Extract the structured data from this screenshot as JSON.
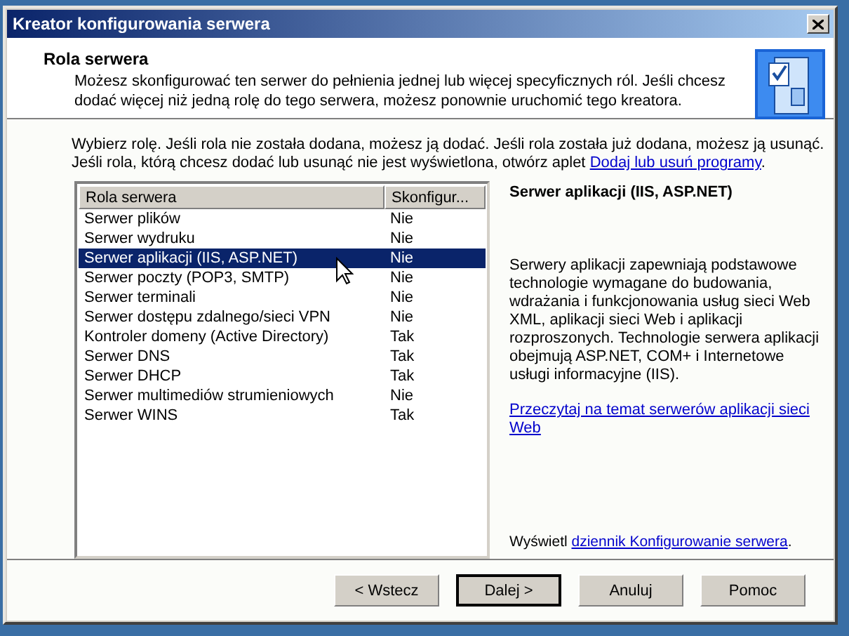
{
  "window": {
    "title": "Kreator konfigurowania serwera"
  },
  "header": {
    "title": "Rola serwera",
    "description": "Możesz skonfigurować ten serwer do pełnienia jednej lub więcej specyficznych ról. Jeśli chcesz dodać więcej niż jedną rolę do tego serwera, możesz ponownie uruchomić tego kreatora."
  },
  "instructions": {
    "text": "Wybierz rolę. Jeśli rola nie została dodana, możesz ją dodać. Jeśli rola została już dodana, możesz ją usunąć. Jeśli rola, którą chcesz dodać lub usunąć nie jest wyświetlona, otwórz aplet",
    "link": "Dodaj lub usuń programy",
    "suffix": "."
  },
  "table": {
    "columns": [
      "Rola serwera",
      "Skonfigur..."
    ],
    "rows": [
      {
        "role": "Serwer plików",
        "configured": "Nie",
        "selected": false
      },
      {
        "role": "Serwer wydruku",
        "configured": "Nie",
        "selected": false
      },
      {
        "role": "Serwer aplikacji (IIS, ASP.NET)",
        "configured": "Nie",
        "selected": true
      },
      {
        "role": "Serwer poczty (POP3, SMTP)",
        "configured": "Nie",
        "selected": false
      },
      {
        "role": "Serwer terminali",
        "configured": "Nie",
        "selected": false
      },
      {
        "role": "Serwer dostępu zdalnego/sieci VPN",
        "configured": "Nie",
        "selected": false
      },
      {
        "role": "Kontroler domeny (Active Directory)",
        "configured": "Tak",
        "selected": false
      },
      {
        "role": "Serwer DNS",
        "configured": "Tak",
        "selected": false
      },
      {
        "role": "Serwer DHCP",
        "configured": "Tak",
        "selected": false
      },
      {
        "role": "Serwer multimediów strumieniowych",
        "configured": "Nie",
        "selected": false
      },
      {
        "role": "Serwer WINS",
        "configured": "Tak",
        "selected": false
      }
    ]
  },
  "details": {
    "title": "Serwer aplikacji (IIS, ASP.NET)",
    "description": "Serwery aplikacji zapewniają podstawowe technologie wymagane do budowania, wdrażania i funkcjonowania usług sieci Web XML, aplikacji sieci Web i aplikacji rozproszonych. Technologie serwera aplikacji obejmują ASP.NET, COM+ i Internetowe usługi informacyjne (IIS).",
    "link": "Przeczytaj na temat serwerów aplikacji sieci Web",
    "log_prefix": "Wyświetl",
    "log_link": "dziennik Konfigurowanie serwera",
    "log_suffix": "."
  },
  "buttons": [
    {
      "label": "< Wstecz",
      "default": false
    },
    {
      "label": "Dalej >",
      "default": true
    },
    {
      "label": "Anuluj",
      "default": false
    },
    {
      "label": "Pomoc",
      "default": false
    }
  ]
}
